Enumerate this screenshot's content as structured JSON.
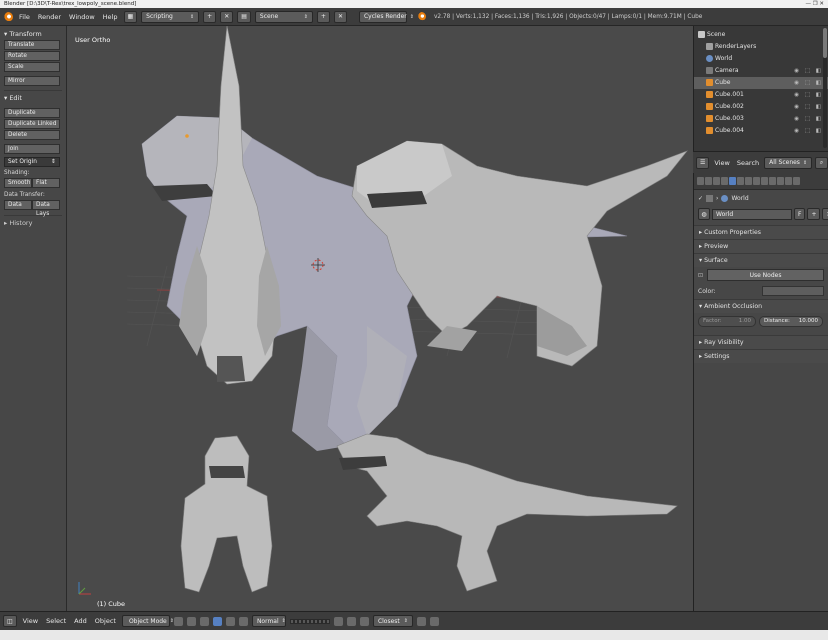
{
  "titlebar": {
    "text": "Blender [D:\\3D\\T-Rex\\trex_lowpoly_scene.blend]",
    "window_controls": "—  ❐  ✕"
  },
  "menubar": {
    "menus": [
      "File",
      "Render",
      "Window",
      "Help"
    ],
    "layout": "Scripting",
    "scene": "Scene",
    "engine": "Cycles Render",
    "stats": "v2.78 | Verts:1,132 | Faces:1,136 | Tris:1,926 | Objects:0/47 | Lamps:0/1 | Mem:9.71M | Cube"
  },
  "toolshelf": {
    "transform": {
      "header": "▾ Transform",
      "buttons": [
        "Translate",
        "Rotate",
        "Scale"
      ],
      "mirror": "Mirror"
    },
    "edit": {
      "header": "▾ Edit",
      "buttons": [
        "Duplicate",
        "Duplicate Linked",
        "Delete"
      ],
      "join": "Join",
      "set_origin": "Set Origin"
    },
    "shading": {
      "label": "Shading:",
      "smooth": "Smooth",
      "flat": "Flat"
    },
    "data_transfer": {
      "label": "Data Transfer:",
      "data": "Data",
      "data_lays": "Data Lays"
    },
    "history": "▸ History"
  },
  "viewport": {
    "view_name": "User Ortho",
    "object_label": "(1) Cube"
  },
  "outliner": {
    "items": [
      {
        "label": "Scene",
        "icon": "scene-icon",
        "color": "#c8c8c8",
        "vis": ""
      },
      {
        "label": "RenderLayers",
        "icon": "renderlayers-icon",
        "color": "#a0a0a0",
        "vis": ""
      },
      {
        "label": "World",
        "icon": "world-icon",
        "color": "#6a8fc4",
        "vis": ""
      },
      {
        "label": "Camera",
        "icon": "camera-icon",
        "color": "#7a7a7a",
        "vis": "◉ ⬚ ◧"
      },
      {
        "label": "Cube",
        "icon": "cube-icon",
        "color": "#e28e2e",
        "vis": "◉ ⬚ ◧"
      },
      {
        "label": "Cube.001",
        "icon": "cube-icon",
        "color": "#e28e2e",
        "vis": "◉ ⬚ ◧"
      },
      {
        "label": "Cube.002",
        "icon": "cube-icon",
        "color": "#e28e2e",
        "vis": "◉ ⬚ ◧"
      },
      {
        "label": "Cube.003",
        "icon": "cube-icon",
        "color": "#e28e2e",
        "vis": "◉ ⬚ ◧"
      },
      {
        "label": "Cube.004",
        "icon": "cube-icon",
        "color": "#e28e2e",
        "vis": "◉ ⬚ ◧"
      }
    ]
  },
  "outliner_header": {
    "view": "View",
    "search": "Search",
    "filter": "All Scenes"
  },
  "properties": {
    "context": "World",
    "datablock": "World",
    "datablock_f": "F",
    "sections": {
      "custom_properties": "▸ Custom Properties",
      "preview": "▸ Preview",
      "surface": "▾ Surface",
      "ambient_occlusion": "▾  Ambient Occlusion",
      "ray_visibility": "▸ Ray Visibility",
      "settings": "▸ Settings"
    },
    "use_nodes": "Use Nodes",
    "color_label": "Color:",
    "factor_label": "Factor:",
    "factor_value": "1.00",
    "distance_label": "Distance:",
    "distance_value": "10.000"
  },
  "footer": {
    "menus": [
      "View",
      "Select",
      "Add",
      "Object"
    ],
    "mode": "Object Mode",
    "pivot": "Normal",
    "snap": "Closest"
  },
  "colors": {
    "selected_accent": "#e28e2e",
    "active_tab": "#5680c2",
    "viewport_bg": "#4a4a4a"
  }
}
